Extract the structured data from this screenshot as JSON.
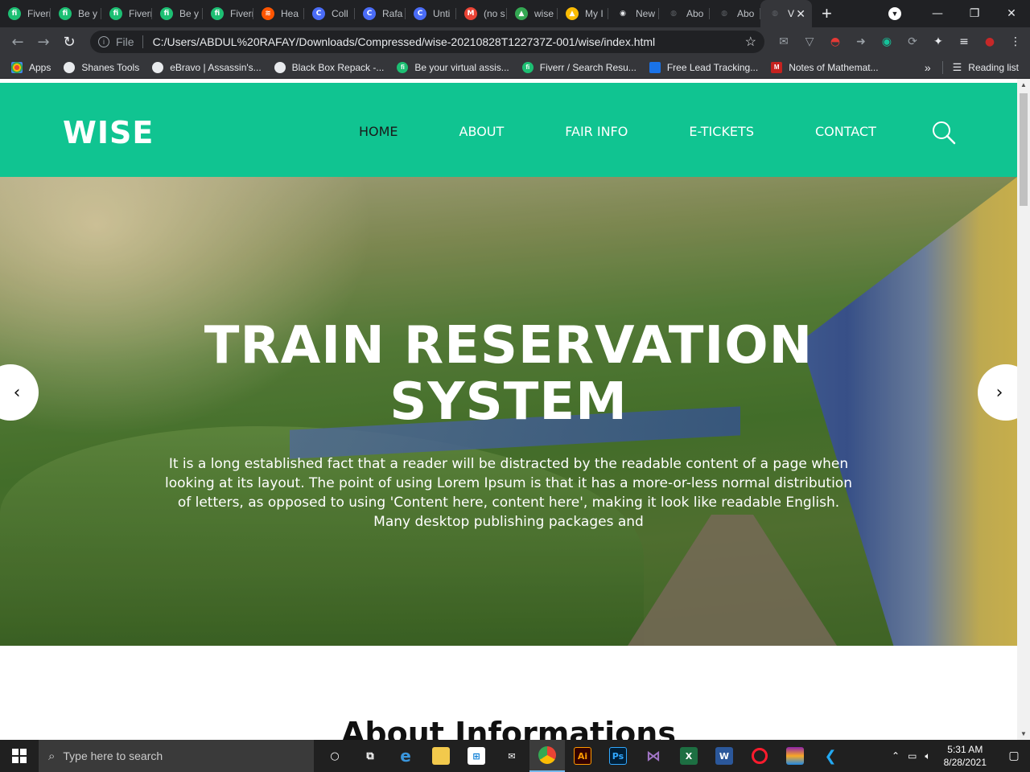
{
  "browser": {
    "tabs": [
      {
        "label": "Fiverr",
        "icon": "fiverr-icon",
        "color": "#1dbf73",
        "glyph": "fi"
      },
      {
        "label": "Be y",
        "icon": "fiverr-icon",
        "color": "#1dbf73",
        "glyph": "fi"
      },
      {
        "label": "Fiverr",
        "icon": "fiverr-icon",
        "color": "#1dbf73",
        "glyph": "fi"
      },
      {
        "label": "Be y",
        "icon": "fiverr-icon",
        "color": "#1dbf73",
        "glyph": "fi"
      },
      {
        "label": "Fiverr",
        "icon": "fiverr-icon",
        "color": "#1dbf73",
        "glyph": "fi"
      },
      {
        "label": "Hea",
        "icon": "soundcloud-icon",
        "color": "#ff5500",
        "glyph": "≋"
      },
      {
        "label": "Coll",
        "icon": "canva-icon",
        "color": "#4a6cf7",
        "glyph": "C"
      },
      {
        "label": "Rafa",
        "icon": "canva-icon",
        "color": "#4a6cf7",
        "glyph": "C"
      },
      {
        "label": "Unti",
        "icon": "canva-icon",
        "color": "#4a6cf7",
        "glyph": "C"
      },
      {
        "label": "(no s",
        "icon": "gmail-icon",
        "color": "#ea4335",
        "glyph": "M"
      },
      {
        "label": "wise",
        "icon": "google-drive-icon",
        "color": "#34a853",
        "glyph": "▲"
      },
      {
        "label": "My I",
        "icon": "google-drive-icon",
        "color": "#fbbc04",
        "glyph": "▲"
      },
      {
        "label": "New",
        "icon": "chrome-icon",
        "color": "#e8eaed",
        "glyph": "◉"
      },
      {
        "label": "Abo",
        "icon": "globe-icon",
        "color": "#5f6368",
        "glyph": "◍"
      },
      {
        "label": "Abo",
        "icon": "globe-icon",
        "color": "#5f6368",
        "glyph": "◍"
      },
      {
        "label": "V",
        "icon": "globe-icon",
        "color": "#5f6368",
        "glyph": "◍",
        "active": true
      }
    ],
    "url_scheme": "File",
    "url": "C:/Users/ABDUL%20RAFAY/Downloads/Compressed/wise-20210828T122737Z-001/wise/index.html",
    "bookmarks": [
      {
        "label": "Apps",
        "icon": "apps-grid-icon",
        "color": "#ea4335"
      },
      {
        "label": "Shanes Tools",
        "icon": "globe-icon",
        "color": "#e8eaed"
      },
      {
        "label": "eBravo | Assassin's...",
        "icon": "globe-icon",
        "color": "#e8eaed"
      },
      {
        "label": "Black Box Repack -...",
        "icon": "globe-icon",
        "color": "#e8eaed"
      },
      {
        "label": "Be your virtual assis...",
        "icon": "fiverr-icon",
        "color": "#1dbf73"
      },
      {
        "label": "Fiverr / Search Resu...",
        "icon": "fiverr-icon",
        "color": "#1dbf73"
      },
      {
        "label": "Free Lead Tracking...",
        "icon": "bookmark-icon",
        "color": "#1a73e8"
      },
      {
        "label": "Notes of Mathemat...",
        "icon": "m-logo-icon",
        "color": "#c5221f"
      }
    ],
    "reading_list": "Reading list"
  },
  "site": {
    "logo": "WISE",
    "nav": [
      {
        "label": "HOME",
        "active": true
      },
      {
        "label": "ABOUT"
      },
      {
        "label": "FAIR INFO"
      },
      {
        "label": "E-TICKETS"
      },
      {
        "label": "CONTACT"
      }
    ],
    "hero_title_line1": "TRAIN RESERVATION",
    "hero_title_line2": "SYSTEM",
    "hero_text": "It is a long established fact that a reader will be distracted by the readable content of a page when looking at its layout. The point of using Lorem Ipsum is that it has a more-or-less normal distribution of letters, as opposed to using 'Content here, content here', making it look like readable English. Many desktop publishing packages and",
    "section_title": "About Informations",
    "accent_color": "#10c491"
  },
  "taskbar": {
    "search_placeholder": "Type here to search",
    "time": "5:31 AM",
    "date": "8/28/2021"
  }
}
